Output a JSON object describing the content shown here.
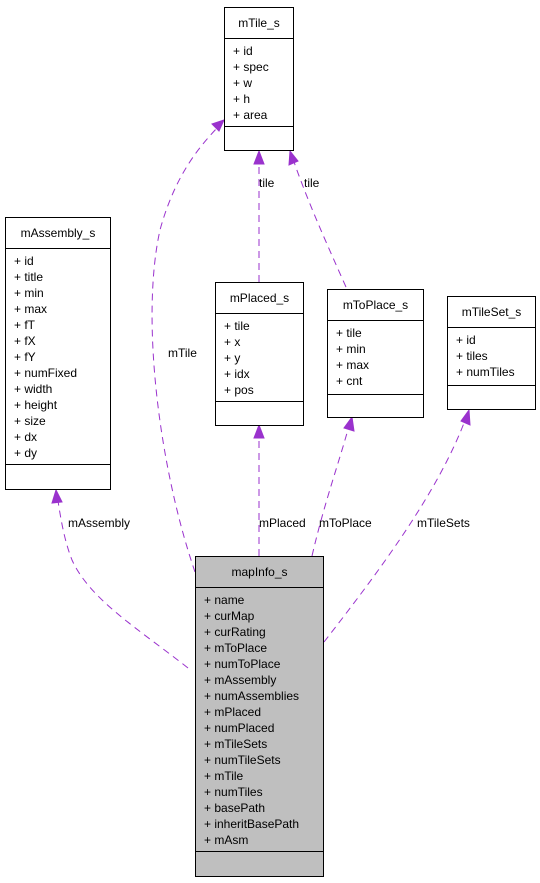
{
  "diagram": {
    "type": "collaboration-diagram",
    "edge_color": "#9a32cd",
    "main_node_fill": "#bfbfbf",
    "nodes": [
      {
        "id": "mTile_s",
        "title": "mTile_s",
        "attributes": [
          "+ id",
          "+ spec",
          "+ w",
          "+ h",
          "+ area"
        ],
        "highlighted": false
      },
      {
        "id": "mAssembly_s",
        "title": "mAssembly_s",
        "attributes": [
          "+ id",
          "+ title",
          "+ min",
          "+ max",
          "+ fT",
          "+ fX",
          "+ fY",
          "+ numFixed",
          "+ width",
          "+ height",
          "+ size",
          "+ dx",
          "+ dy"
        ],
        "highlighted": false
      },
      {
        "id": "mPlaced_s",
        "title": "mPlaced_s",
        "attributes": [
          "+ tile",
          "+ x",
          "+ y",
          "+ idx",
          "+ pos"
        ],
        "highlighted": false
      },
      {
        "id": "mToPlace_s",
        "title": "mToPlace_s",
        "attributes": [
          "+ tile",
          "+ min",
          "+ max",
          "+ cnt"
        ],
        "highlighted": false
      },
      {
        "id": "mTileSet_s",
        "title": "mTileSet_s",
        "attributes": [
          "+ id",
          "+ tiles",
          "+ numTiles"
        ],
        "highlighted": false
      },
      {
        "id": "mapInfo_s",
        "title": "mapInfo_s",
        "attributes": [
          "+ name",
          "+ curMap",
          "+ curRating",
          "+ mToPlace",
          "+ numToPlace",
          "+ mAssembly",
          "+ numAssemblies",
          "+ mPlaced",
          "+ numPlaced",
          "+ mTileSets",
          "+ numTileSets",
          "+ mTile",
          "+ numTiles",
          "+ basePath",
          "+ inheritBasePath",
          "+ mAsm"
        ],
        "highlighted": true
      }
    ],
    "edges": [
      {
        "from": "mapInfo_s",
        "to": "mTile_s",
        "label": "mTile"
      },
      {
        "from": "mapInfo_s",
        "to": "mAssembly_s",
        "label": "mAssembly"
      },
      {
        "from": "mapInfo_s",
        "to": "mPlaced_s",
        "label": "mPlaced"
      },
      {
        "from": "mapInfo_s",
        "to": "mToPlace_s",
        "label": "mToPlace"
      },
      {
        "from": "mapInfo_s",
        "to": "mTileSet_s",
        "label": "mTileSets"
      },
      {
        "from": "mPlaced_s",
        "to": "mTile_s",
        "label": "tile"
      },
      {
        "from": "mToPlace_s",
        "to": "mTile_s",
        "label": "tile"
      }
    ]
  }
}
